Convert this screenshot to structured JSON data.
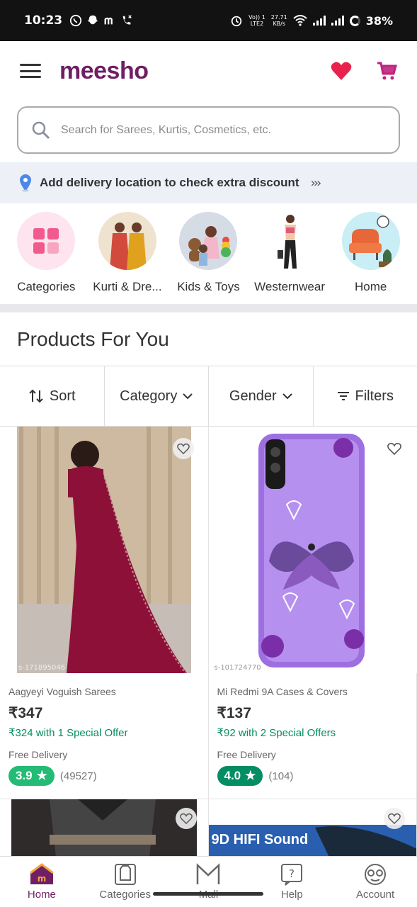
{
  "status_bar": {
    "time": "10:23",
    "app_icons": [
      "whatsapp-icon",
      "snapchat-icon",
      "m-icon",
      "missed-call-icon"
    ],
    "net_top": "Vo)) 1",
    "net_bottom": "LTE2",
    "speed_top": "27.71",
    "speed_bottom": "KB/s",
    "battery": "38%"
  },
  "header": {
    "logo": "meesho"
  },
  "search": {
    "placeholder": "Search for Sarees, Kurtis, Cosmetics, etc."
  },
  "delivery": {
    "text": "Add delivery location to check extra discount",
    "arrows": "›››"
  },
  "categories": [
    {
      "label": "Categories"
    },
    {
      "label": "Kurti & Dre..."
    },
    {
      "label": "Kids & Toys"
    },
    {
      "label": "Westernwear"
    },
    {
      "label": "Home"
    }
  ],
  "section_title": "Products For You",
  "filters": {
    "sort": "Sort",
    "category": "Category",
    "gender": "Gender",
    "filters": "Filters"
  },
  "products": [
    {
      "code": "s-171895046",
      "title": "Aagyeyi Voguish Sarees",
      "price": "₹347",
      "offer": "₹324 with 1 Special Offer",
      "delivery": "Free Delivery",
      "rating": "3.9",
      "reviews": "(49527)"
    },
    {
      "code": "s-101724770",
      "title": "Mi Redmi 9A Cases & Covers",
      "price": "₹137",
      "offer": "₹92 with 2 Special Offers",
      "delivery": "Free Delivery",
      "rating": "4.0",
      "reviews": "(104)"
    }
  ],
  "partial_products": [
    {
      "banner_text": ""
    },
    {
      "banner_text": "9D HIFI Sound"
    }
  ],
  "bottom_nav": [
    {
      "label": "Home",
      "active": true
    },
    {
      "label": "Categories",
      "active": false
    },
    {
      "label": "Mall",
      "active": false
    },
    {
      "label": "Help",
      "active": false
    },
    {
      "label": "Account",
      "active": false
    }
  ],
  "colors": {
    "brand": "#6f1f63",
    "heart": "#e8224d",
    "cart": "#c0237e",
    "rating_green": "#23bb75",
    "offer_green": "#038d63"
  }
}
